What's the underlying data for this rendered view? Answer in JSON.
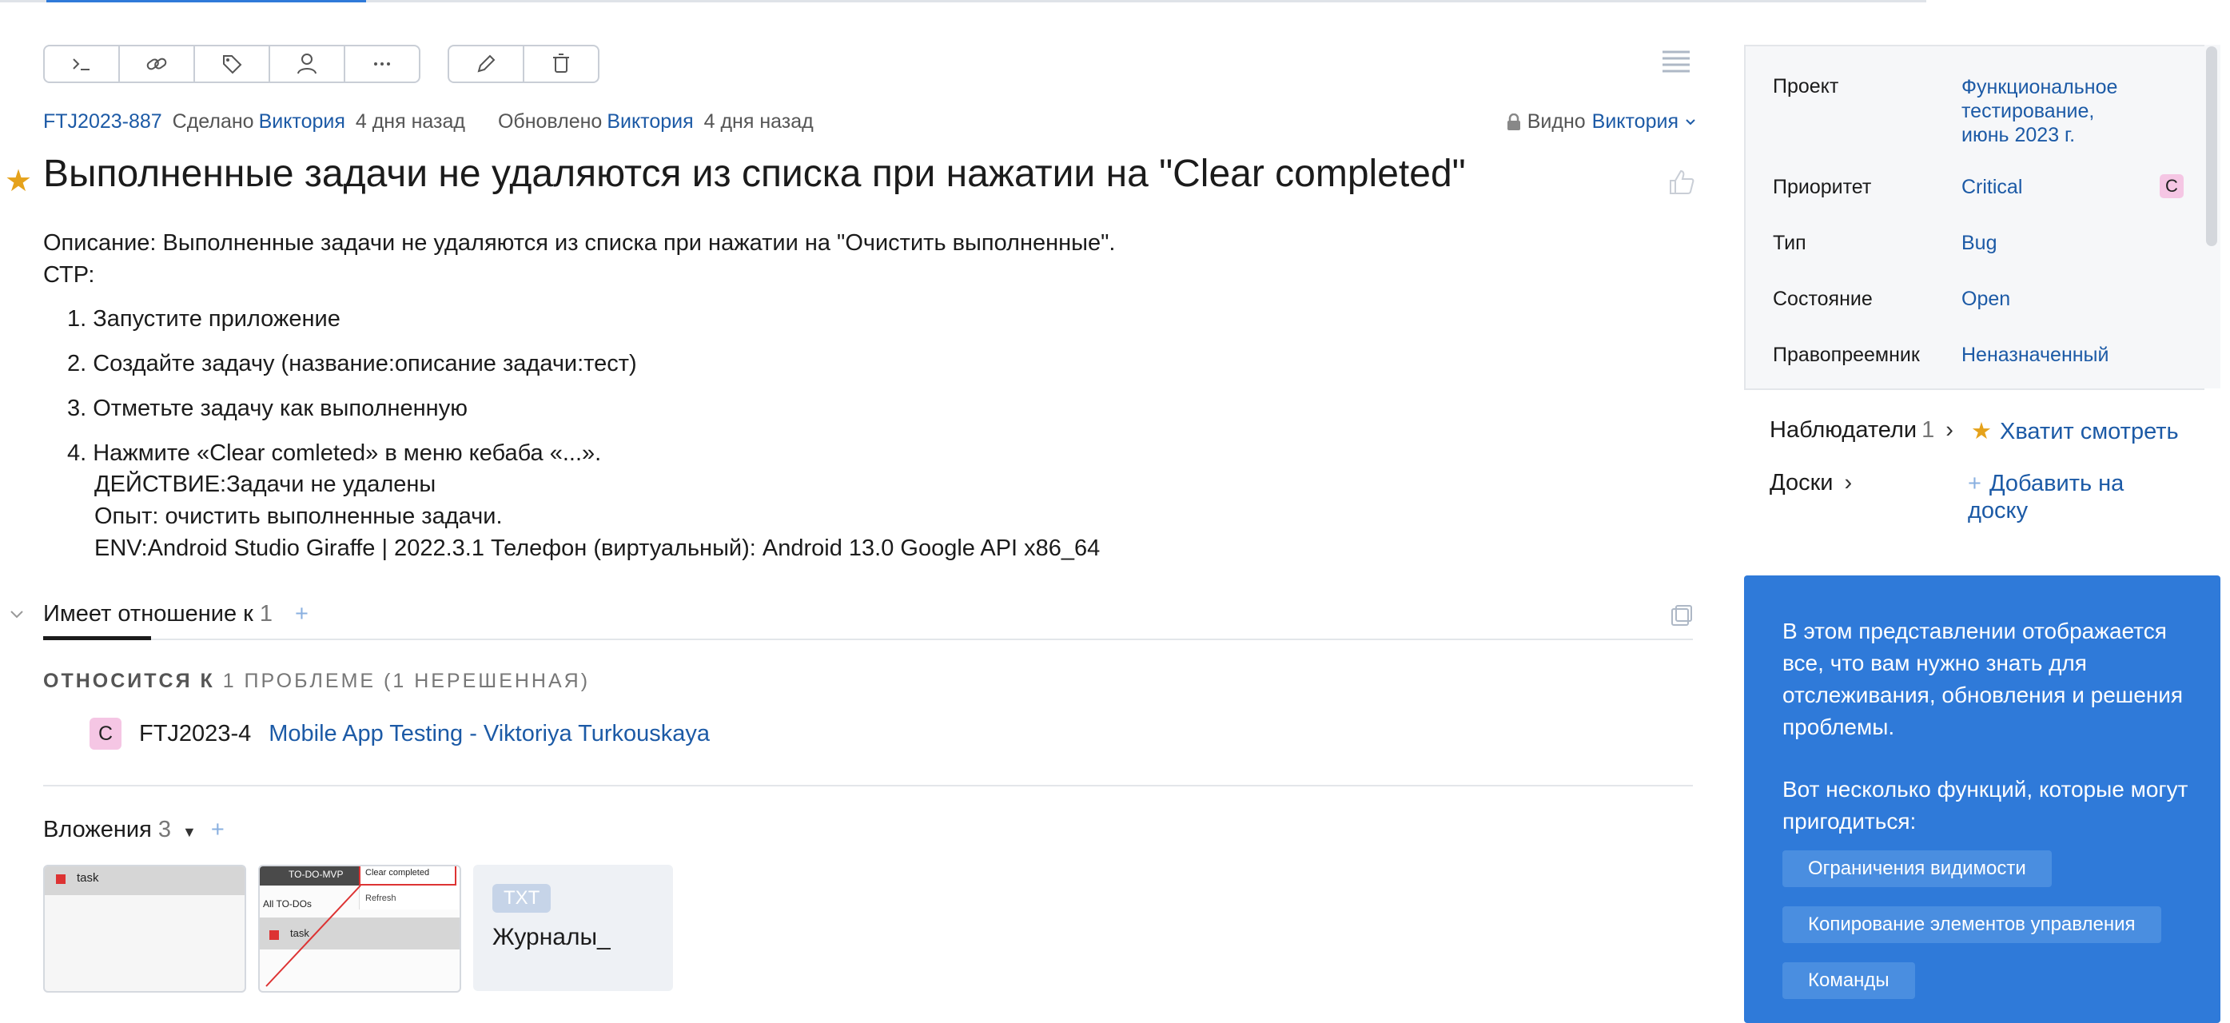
{
  "toolbar": {
    "icons": [
      "command-icon",
      "link-icon",
      "tag-icon",
      "assign-user-icon",
      "more-icon",
      "edit-icon",
      "delete-icon"
    ]
  },
  "issue": {
    "id": "FTJ2023-887",
    "created_label": "Сделано",
    "created_by": "Виктория",
    "created_ago": "4 дня назад",
    "updated_label": "Обновлено",
    "updated_by": "Виктория",
    "updated_ago": "4 дня назад",
    "visibility_label": "Видно",
    "visibility_user": "Виктория",
    "title": "Выполненные задачи не удаляются из списка при нажатии на \"Clear completed\"",
    "description_line1": "Описание: Выполненные задачи не удаляются из списка при нажатии на \"Очистить выполненные\".",
    "description_line2": "СТР:",
    "steps": [
      "1. Запустите приложение",
      "2. Создайте задачу (название:описание задачи:тест)",
      "3. Отметьте задачу как выполненную",
      "4. Нажмите «Clear comleted» в меню кебаба «...»."
    ],
    "extra_lines": [
      "ДЕЙСТВИЕ:Задачи не удалены",
      "Опыт: очистить выполненные задачи.",
      "ENV:Android Studio Giraffe | 2022.3.1 Телефон (виртуальный): Android 13.0 Google API x86_64"
    ]
  },
  "relations": {
    "header": "Имеет отношение к",
    "count": "1",
    "plus": "+",
    "sub_label": "ОТНОСИТСЯ К",
    "sub_detail": "1 ПРОБЛЕМЕ (1 НЕРЕШЕННАЯ)",
    "items": [
      {
        "badge": "C",
        "id": "FTJ2023-4",
        "summary": "Mobile App Testing - Viktoriya Turkouskaya"
      }
    ]
  },
  "attachments": {
    "header": "Вложения",
    "count": "3",
    "plus": "+",
    "thumb1_text": "task",
    "thumb2_title": "TO-DO-MVP",
    "thumb2_menu1": "Clear completed",
    "thumb2_menu2": "Refresh",
    "thumb2_all": "All TO-DOs",
    "thumb2_task": "task",
    "file_badge": "TXT",
    "file_name": "Журналы_"
  },
  "properties": [
    {
      "label": "Проект",
      "value": "Функциональное тестирование, июнь 2023 г."
    },
    {
      "label": "Приоритет",
      "value": "Critical",
      "badge": "C"
    },
    {
      "label": "Тип",
      "value": "Bug"
    },
    {
      "label": "Состояние",
      "value": "Open"
    },
    {
      "label": "Правопреемник",
      "value": "Неназначенный"
    }
  ],
  "watchers": {
    "label": "Наблюдатели",
    "count": "1",
    "action": "Хватит смотреть"
  },
  "boards": {
    "label": "Доски",
    "action": "Добавить на доску"
  },
  "promo": {
    "text1": "В этом представлении отображается все, что вам нужно знать для отслеживания, обновления и решения проблемы.",
    "text2": "Вот несколько функций, которые могут пригодиться:",
    "buttons": [
      "Ограничения видимости",
      "Копирование элементов управления",
      "Команды"
    ]
  },
  "colors": {
    "link": "#1c5aa6",
    "accent": "#2f7ad9",
    "star": "#e5a21b",
    "badge_pink": "#f5c6e4"
  }
}
